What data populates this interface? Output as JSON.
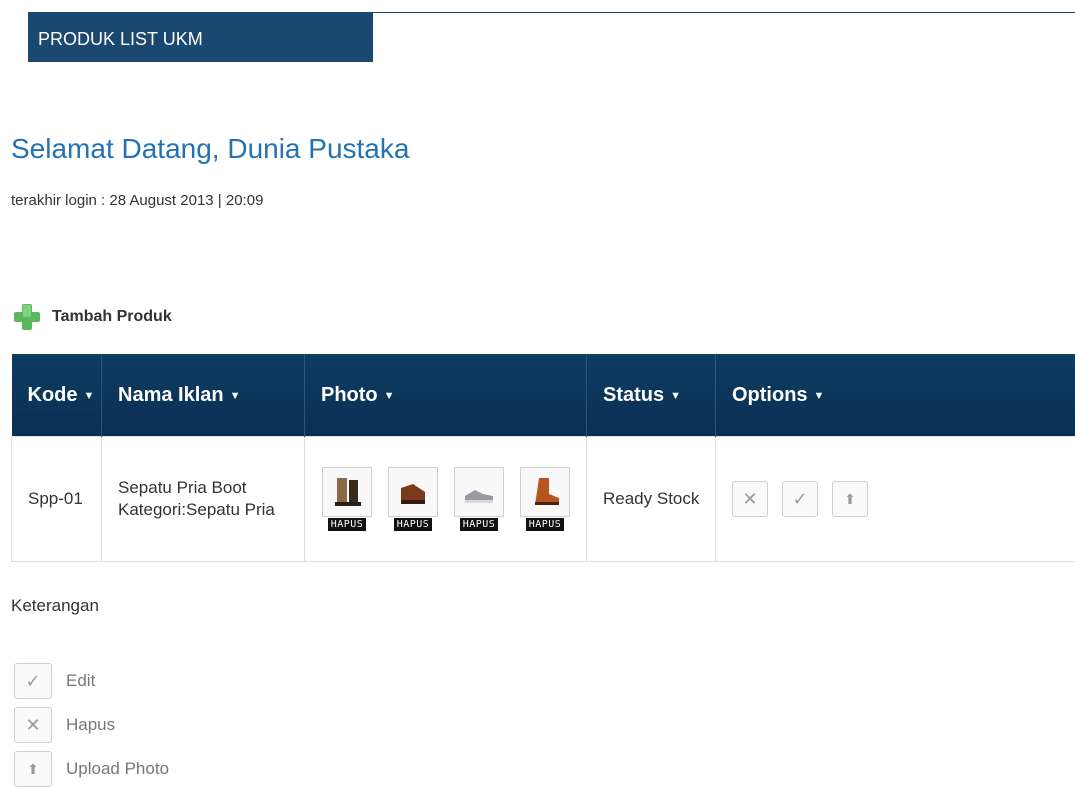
{
  "header": {
    "title": "PRODUK LIST UKM"
  },
  "welcome": {
    "greeting": "Selamat Datang, Dunia Pustaka",
    "last_login": "terakhir login : 28 August 2013 | 20:09"
  },
  "toolbar": {
    "add_label": "Tambah Produk"
  },
  "table": {
    "columns": [
      "Kode",
      "Nama Iklan",
      "Photo",
      "Status",
      "Options"
    ],
    "rows": [
      {
        "kode": "Spp-01",
        "nama": "Sepatu Pria Boot",
        "kategori": "Kategori:Sepatu Pria",
        "photos": [
          {
            "icon": "boot-photo-icon",
            "badge": "HAPUS"
          },
          {
            "icon": "boot-photo-icon",
            "badge": "HAPUS"
          },
          {
            "icon": "sneaker-photo-icon",
            "badge": "HAPUS"
          },
          {
            "icon": "boot-photo-icon",
            "badge": "HAPUS"
          }
        ],
        "status": "Ready Stock",
        "options": [
          "close-icon",
          "check-icon",
          "arrow-up-icon"
        ]
      }
    ]
  },
  "legend": {
    "title": "Keterangan",
    "items": [
      {
        "icon": "check-icon",
        "label": "Edit"
      },
      {
        "icon": "close-icon",
        "label": "Hapus"
      },
      {
        "icon": "arrow-up-icon",
        "label": "Upload Photo"
      }
    ]
  },
  "colors": {
    "header_bg": "#1a4870",
    "table_header_bg": "#0a2f52",
    "link_blue": "#2372b3",
    "plus_green": "#5cb85c"
  }
}
